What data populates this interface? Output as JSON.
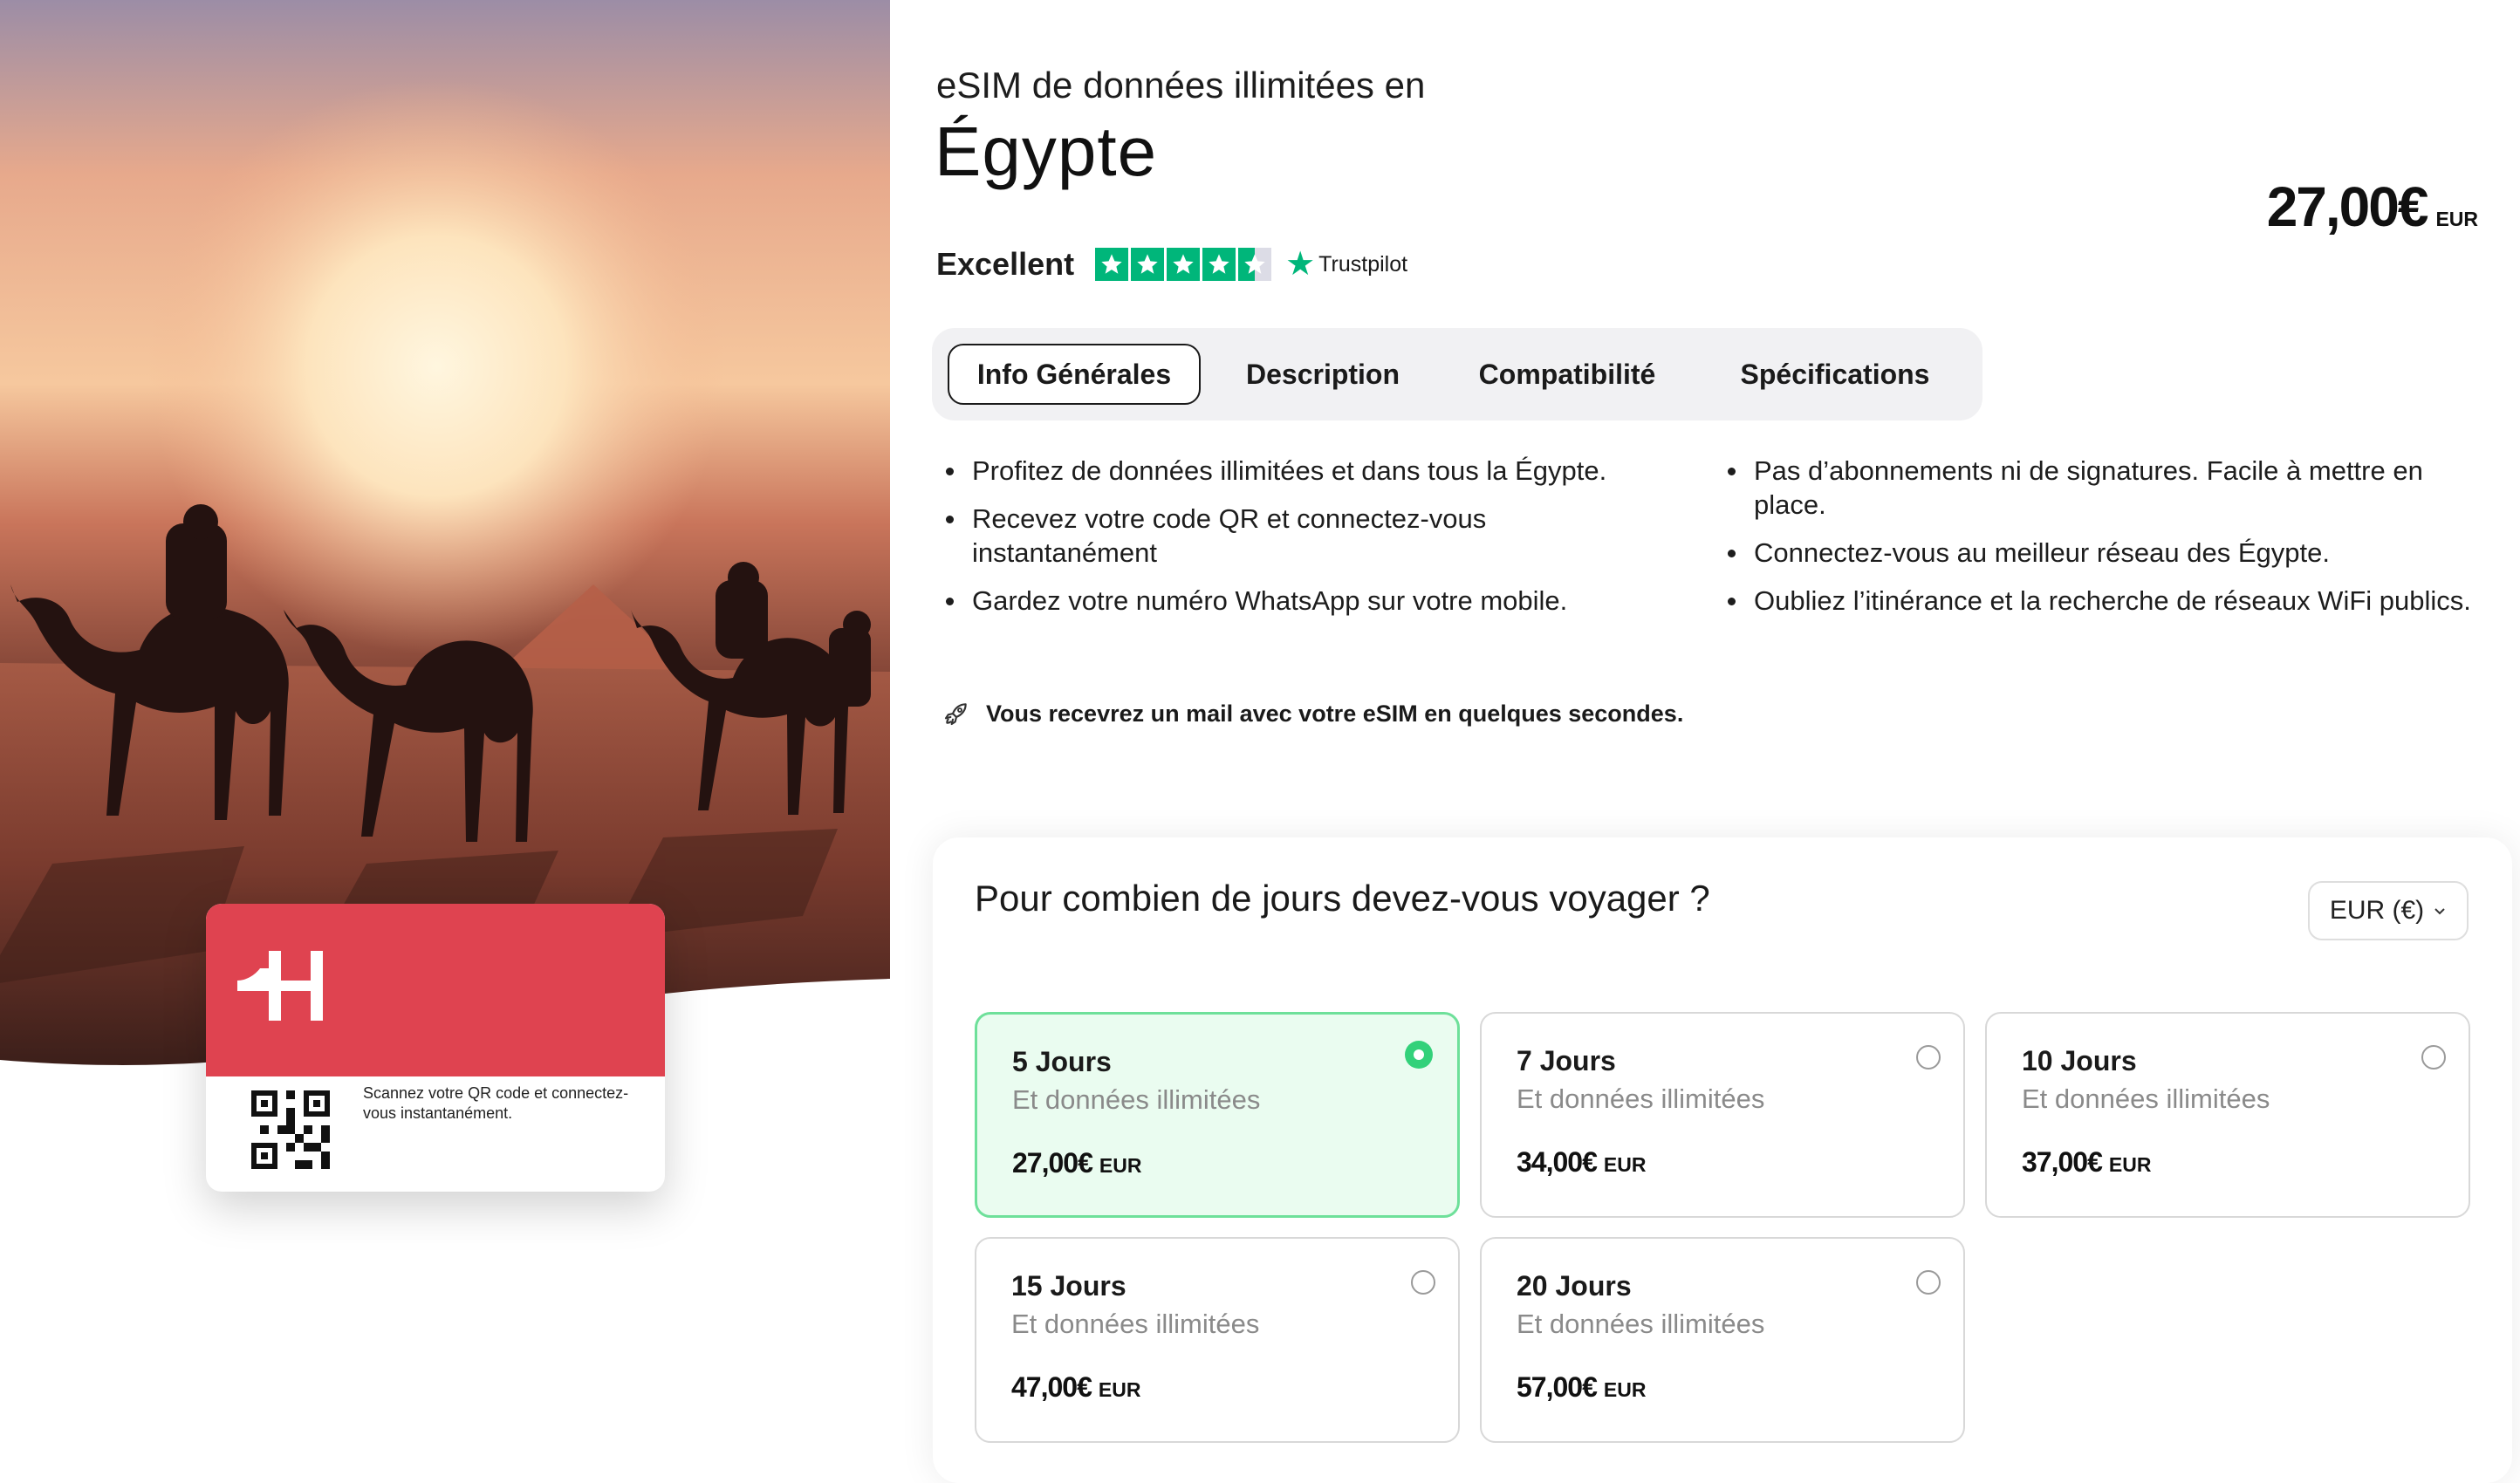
{
  "product": {
    "subtitle": "eSIM de données illimitées en",
    "country": "Égypte",
    "price": "27,00€",
    "currency": "EUR"
  },
  "rating": {
    "label": "Excellent",
    "stars": 4.5,
    "provider": "Trustpilot",
    "color": "#00b67a"
  },
  "sim_card": {
    "brand_color": "#df4350",
    "text": "Scannez votre QR code et connectez-vous instantanément."
  },
  "tabs": [
    {
      "label": "Info Générales",
      "active": true
    },
    {
      "label": "Description",
      "active": false
    },
    {
      "label": "Compatibilité",
      "active": false
    },
    {
      "label": "Spécifications",
      "active": false
    }
  ],
  "features": {
    "left": [
      "Profitez de données illimitées et dans tous la Égypte.",
      "Recevez votre code QR et connectez-vous instantanément",
      "Gardez votre numéro WhatsApp sur votre mobile."
    ],
    "right": [
      "Pas d’abonnements ni de signatures. Facile à mettre en place.",
      "Connectez-vous au meilleur réseau des Égypte.",
      "Oubliez l’itinérance et la recherche de réseaux WiFi publics."
    ]
  },
  "mail_note": {
    "icon": "rocket-icon",
    "text": "Vous recevrez un mail avec votre eSIM en quelques secondes."
  },
  "days": {
    "question": "Pour combien de jours devez-vous voyager ?",
    "currency_select": "EUR (€)",
    "plans": [
      {
        "title": "5 Jours",
        "sub": "Et données illimitées",
        "price": "27,00€",
        "currency": "EUR",
        "selected": true
      },
      {
        "title": "7 Jours",
        "sub": "Et données illimitées",
        "price": "34,00€",
        "currency": "EUR",
        "selected": false
      },
      {
        "title": "10 Jours",
        "sub": "Et données illimitées",
        "price": "37,00€",
        "currency": "EUR",
        "selected": false
      },
      {
        "title": "15 Jours",
        "sub": "Et données illimitées",
        "price": "47,00€",
        "currency": "EUR",
        "selected": false
      },
      {
        "title": "20 Jours",
        "sub": "Et données illimitées",
        "price": "57,00€",
        "currency": "EUR",
        "selected": false
      }
    ],
    "selected_color": "#33d17a"
  }
}
